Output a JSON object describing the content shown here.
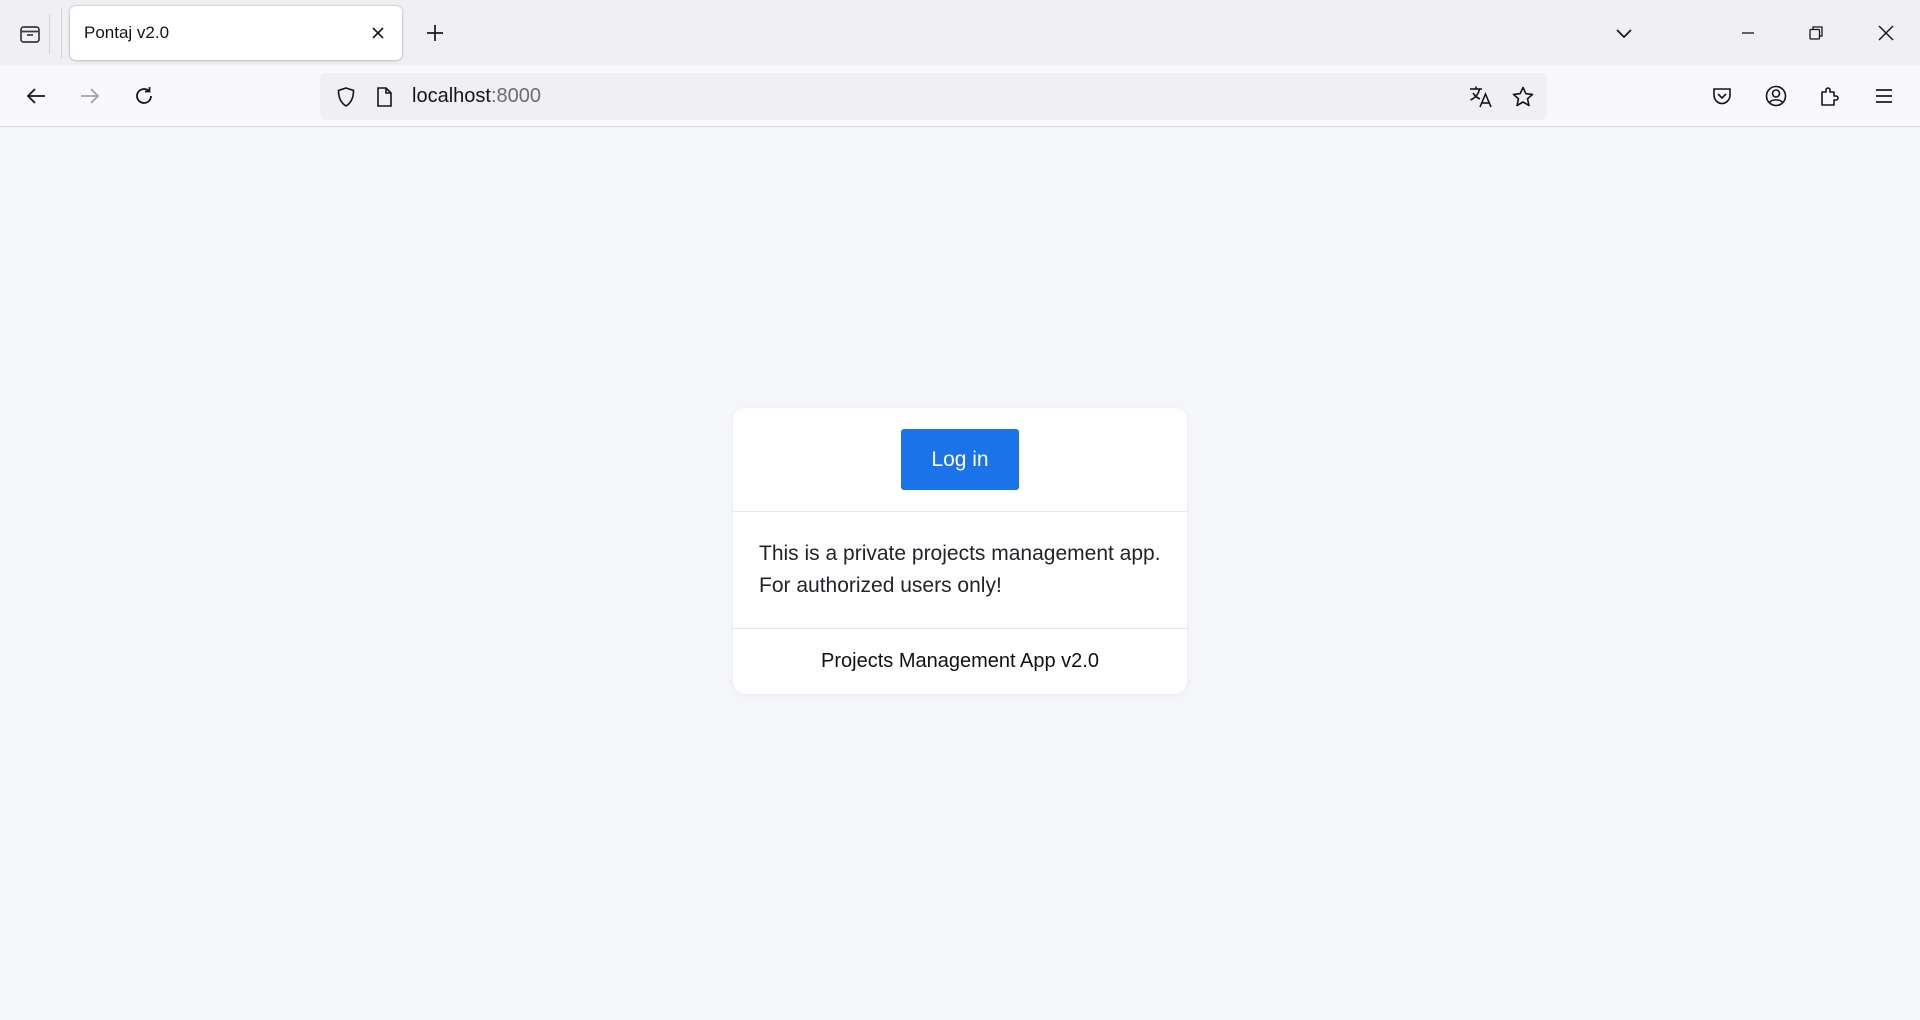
{
  "browser": {
    "tab": {
      "title": "Pontaj v2.0"
    },
    "url": {
      "host": "localhost",
      "port": ":8000"
    },
    "icons": {
      "tab_overview": "firefox-view-icon",
      "close_tab": "close-icon",
      "new_tab": "plus-icon",
      "tab_list": "chevron-down-icon",
      "minimize": "minimize-icon",
      "restore": "restore-icon",
      "close_window": "close-icon",
      "back": "arrow-left-icon",
      "forward": "arrow-right-icon",
      "reload": "reload-icon",
      "tracking_protection": "shield-icon",
      "page_info": "page-icon",
      "translate": "translate-icon",
      "bookmark": "star-icon",
      "pocket": "pocket-icon",
      "account": "account-icon",
      "extensions": "puzzle-icon",
      "menu": "hamburger-menu-icon"
    }
  },
  "page": {
    "login_button": "Log in",
    "notice_line1": "This is a private projects management app.",
    "notice_line2": "For authorized users only!",
    "footer": "Projects Management App v2.0"
  },
  "colors": {
    "accent": "#1a73e8",
    "page_background": "#f5f6fa",
    "card_background": "#ffffff"
  }
}
